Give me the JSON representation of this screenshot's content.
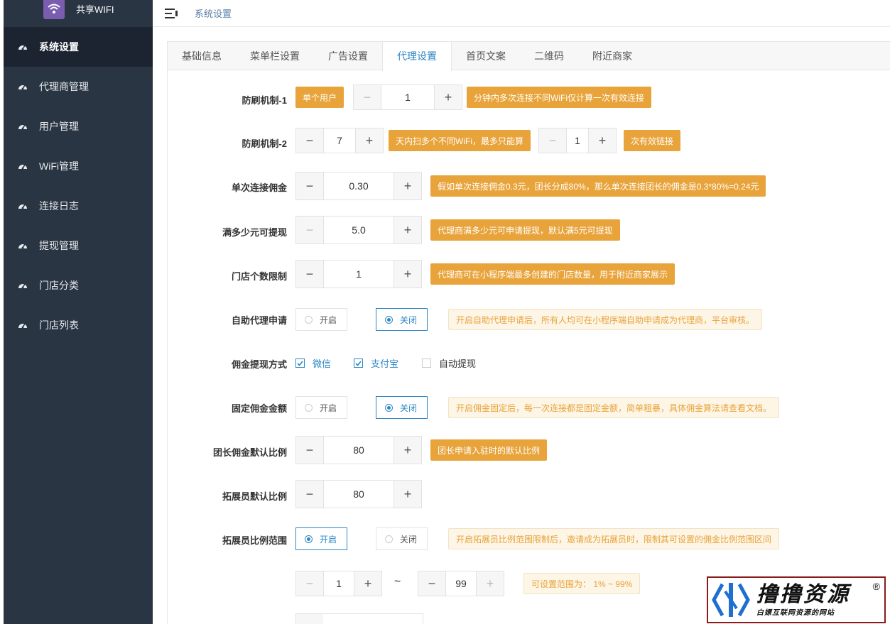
{
  "app": {
    "name": "共享WIFI"
  },
  "breadcrumb": "系统设置",
  "sidebar": {
    "items": [
      {
        "label": "系统设置",
        "active": true
      },
      {
        "label": "代理商管理"
      },
      {
        "label": "用户管理"
      },
      {
        "label": "WiFi管理"
      },
      {
        "label": "连接日志"
      },
      {
        "label": "提现管理"
      },
      {
        "label": "门店分类"
      },
      {
        "label": "门店列表"
      }
    ]
  },
  "tabs": [
    "基础信息",
    "菜单栏设置",
    "广告设置",
    "代理设置",
    "首页文案",
    "二维码",
    "附近商家"
  ],
  "active_tab": "代理设置",
  "form": {
    "anti1": {
      "label": "防刷机制-1",
      "unit_btn": "单个用户",
      "value": "1",
      "tip": "分钟内多次连接不同WiFi仅计算一次有效连接"
    },
    "anti2": {
      "label": "防刷机制-2",
      "value": "7",
      "tip1": "天内扫多个不同WiFi，最多只能算",
      "value2": "1",
      "tip2": "次有效链接"
    },
    "commission": {
      "label": "单次连接佣金",
      "value": "0.30",
      "tip": "假如单次连接佣金0.3元，团长分成80%，那么单次连接团长的佣金是0.3*80%=0.24元"
    },
    "withdraw_min": {
      "label": "满多少元可提现",
      "value": "5.0",
      "tip": "代理商满多少元可申请提现，默认满5元可提现"
    },
    "store_limit": {
      "label": "门店个数限制",
      "value": "1",
      "tip": "代理商可在小程序端最多创建的门店数量，用于附近商家展示"
    },
    "self_apply": {
      "label": "自助代理申请",
      "on": "开启",
      "off": "关闭",
      "selected": "关闭",
      "tip": "开启自助代理申请后，所有人均可在小程序端自助申请成为代理商，平台审核。"
    },
    "withdraw_method": {
      "label": "佣金提现方式",
      "options": [
        {
          "label": "微信",
          "checked": true
        },
        {
          "label": "支付宝",
          "checked": true
        },
        {
          "label": "自动提现",
          "checked": false
        }
      ]
    },
    "fixed_commission": {
      "label": "固定佣金金额",
      "on": "开启",
      "off": "关闭",
      "selected": "关闭",
      "tip": "开启佣金固定后，每一次连接都是固定金额，简单粗暴，具体佣金算法请查看文档。"
    },
    "leader_ratio": {
      "label": "团长佣金默认比例",
      "value": "80",
      "tip": "团长申请入驻时的默认比例"
    },
    "promoter_ratio": {
      "label": "拓展员默认比例",
      "value": "80"
    },
    "promoter_range": {
      "label": "拓展员比例范围",
      "on": "开启",
      "off": "关闭",
      "selected": "开启",
      "tip": "开启拓展员比例范围限制后，邀请成为拓展员时，限制其可设置的佣金比例范围区间",
      "min": "1",
      "max": "99",
      "separator": "~",
      "range_tip": "可设置范围为： 1% ~ 99%"
    }
  },
  "watermark": {
    "title": "撸撸资源",
    "subtitle": "白嫖互联网资源的网站",
    "reg": "®"
  },
  "colors": {
    "sidebar": "#2a3543",
    "accent": "#2d86c4",
    "tip": "#e8a33a"
  }
}
